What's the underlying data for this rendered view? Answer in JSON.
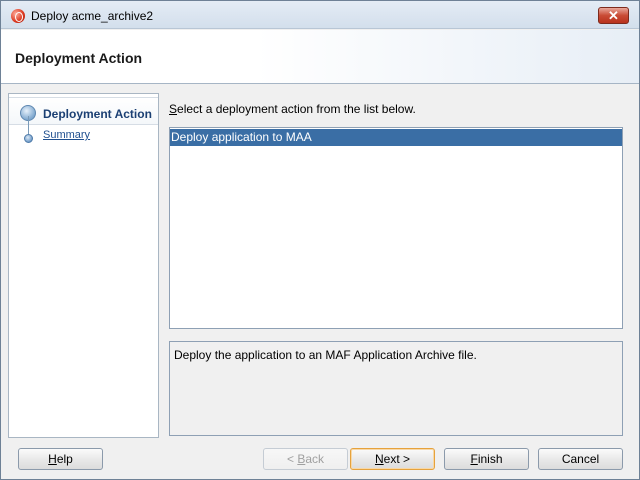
{
  "window": {
    "title": "Deploy acme_archive2",
    "close_symbol": "✕"
  },
  "header": {
    "title": "Deployment Action"
  },
  "nav": {
    "items": [
      {
        "label": "Deployment Action",
        "active": true
      },
      {
        "label": "Summary",
        "active": false
      }
    ]
  },
  "main": {
    "instruction_mnemonic": "S",
    "instruction_rest": "elect a deployment action from the list below.",
    "list_items": [
      "Deploy application to MAA"
    ],
    "selected_index": 0,
    "description": "Deploy the application to an MAF Application Archive file."
  },
  "buttons": {
    "help": {
      "mnemonic": "H",
      "rest": "elp"
    },
    "back": {
      "prefix": "< ",
      "mnemonic": "B",
      "rest": "ack",
      "enabled": false
    },
    "next": {
      "mnemonic": "N",
      "rest": "ext >",
      "default": true
    },
    "finish": {
      "mnemonic": "F",
      "rest": "inish"
    },
    "cancel": "Cancel"
  },
  "colors": {
    "selection": "#3a6ea5",
    "nav_active_text": "#1b3f73",
    "default_button_border": "#e6a23c"
  }
}
